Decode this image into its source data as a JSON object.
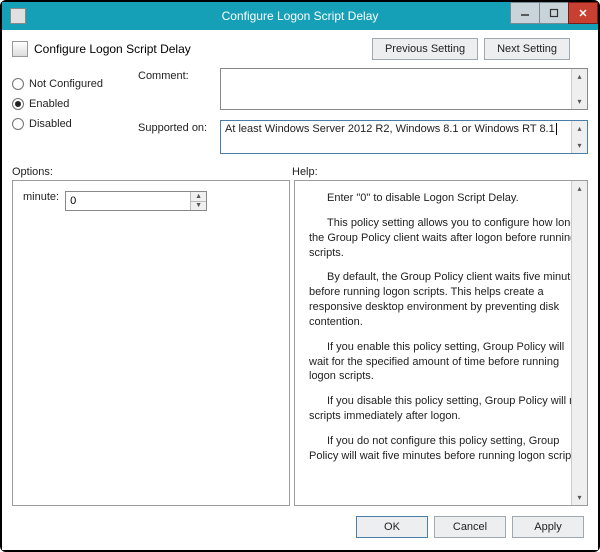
{
  "window": {
    "title": "Configure Logon Script Delay"
  },
  "header": {
    "title": "Configure Logon Script Delay",
    "prev_label": "Previous Setting",
    "next_label": "Next Setting"
  },
  "state": {
    "options": [
      {
        "label": "Not Configured",
        "selected": false
      },
      {
        "label": "Enabled",
        "selected": true
      },
      {
        "label": "Disabled",
        "selected": false
      }
    ]
  },
  "fields": {
    "comment_label": "Comment:",
    "comment_value": "",
    "supported_label": "Supported on:",
    "supported_value": "At least Windows Server 2012 R2, Windows 8.1 or Windows RT 8.1"
  },
  "panes": {
    "options_label": "Options:",
    "help_label": "Help:"
  },
  "options_pane": {
    "minute_label": "minute:",
    "minute_value": "0"
  },
  "help_text": {
    "p1": "Enter \"0\" to disable Logon Script Delay.",
    "p2": "This policy setting allows you to configure how long the Group Policy client waits after logon before running scripts.",
    "p3": "By default, the Group Policy client waits five minutes before running logon scripts. This helps create a responsive desktop environment by preventing disk contention.",
    "p4": "If you enable this policy setting, Group Policy will wait for the specified amount of time before running logon scripts.",
    "p5": "If you disable this policy setting, Group Policy will run scripts immediately after logon.",
    "p6": "If you do not configure this policy setting, Group Policy will wait five minutes before running logon scripts."
  },
  "footer": {
    "ok": "OK",
    "cancel": "Cancel",
    "apply": "Apply"
  }
}
